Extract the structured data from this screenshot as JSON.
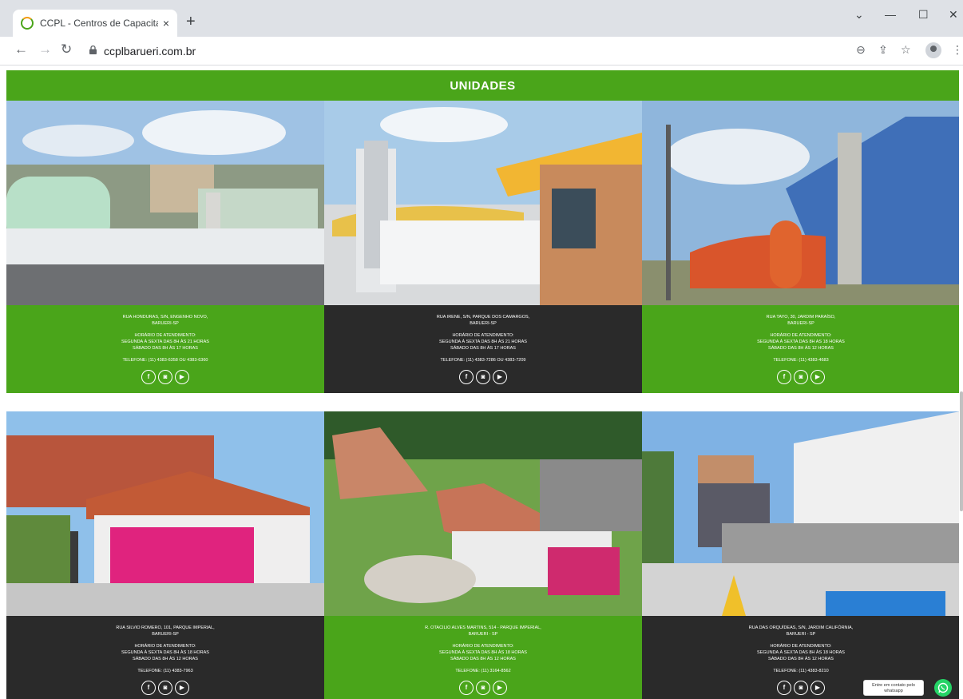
{
  "browser": {
    "tab_title": "CCPL - Centros de Capacitação P",
    "tab_close": "×",
    "new_tab": "+",
    "url": "ccplbarueri.com.br",
    "min": "—",
    "max": "☐",
    "close": "✕",
    "chevron": "⌄"
  },
  "section": {
    "title": "UNIDADES"
  },
  "units": [
    {
      "address1": "RUA HONDURAS, S/N, ENGENHO NOVO,",
      "address2": "BARUERI-SP",
      "hours_label": "HORÁRIO DE ATENDIMENTO:",
      "weekdays": "SEGUNDA À SEXTA DAS 8H ÀS 21 HORAS",
      "saturday": "SÁBADO DAS 8H ÀS 17 HORAS",
      "phone": "TELEFONE: (11) 4383-6358 OU 4383-6360"
    },
    {
      "address1": "RUA IRENE, S/N, PARQUE DOS CAMARGOS,",
      "address2": "BARUERI-SP",
      "hours_label": "HORÁRIO DE ATENDIMENTO:",
      "weekdays": "SEGUNDA À SEXTA DAS 8H ÀS 21 HORAS",
      "saturday": "SÁBADO DAS 8H ÀS 17 HORAS",
      "phone": "TELEFONE: (11) 4383-7286 OU 4383-7209"
    },
    {
      "address1": "RUA TAYO, 30, JARDIM PARAÍSO,",
      "address2": "BARUERI-SP",
      "hours_label": "HORÁRIO DE ATENDIMENTO:",
      "weekdays": "SEGUNDA À SEXTA DAS 8H AS 18 HORAS",
      "saturday": "SÁBADO DAS 8H ÀS 12 HORAS",
      "phone": "TELEFONE: (11) 4383-4683"
    },
    {
      "address1": "RUA SILVIO ROMERO, 101, PARQUE IMPERIAL,",
      "address2": "BARUERI-SP",
      "hours_label": "HORÁRIO DE ATENDIMENTO:",
      "weekdays": "SEGUNDA À SEXTA DAS 8H ÀS 18 HORAS",
      "saturday": "SÁBADO DAS 8H ÀS 12 HORAS",
      "phone": "TELEFONE: (11) 4383-7963"
    },
    {
      "address1": "R. OTACILIO ALVES MARTINS, 514 - PARQUE IMPERIAL,",
      "address2": "BARUERI - SP",
      "hours_label": "HORÁRIO DE ATENDIMENTO:",
      "weekdays": "SEGUNDA À SEXTA DAS 8H ÀS 18 HORAS",
      "saturday": "SÁBADO DAS 8H ÀS 12 HORAS",
      "phone": "TELEFONE: (11) 3164-8562"
    },
    {
      "address1": "RUA DAS ORQUÍDEAS, S/N, JARDIM CALIFÓRNIA,",
      "address2": "BARUERI - SP",
      "hours_label": "HORÁRIO DE ATENDIMENTO:",
      "weekdays": "SEGUNDA À SEXTA DAS 8H ÀS 18 HORAS",
      "saturday": "SÁBADO DAS 8H ÀS 12 HORAS",
      "phone": "TELEFONE: (11) 4383-8210"
    }
  ],
  "social": {
    "facebook": "f",
    "instagram": "◙",
    "youtube": "▶"
  },
  "whatsapp": {
    "label_line1": "Entre em contato pelo",
    "label_line2": "whatsapp"
  },
  "colors": {
    "green": "#4aa51a",
    "dark": "#2a2a2a"
  }
}
